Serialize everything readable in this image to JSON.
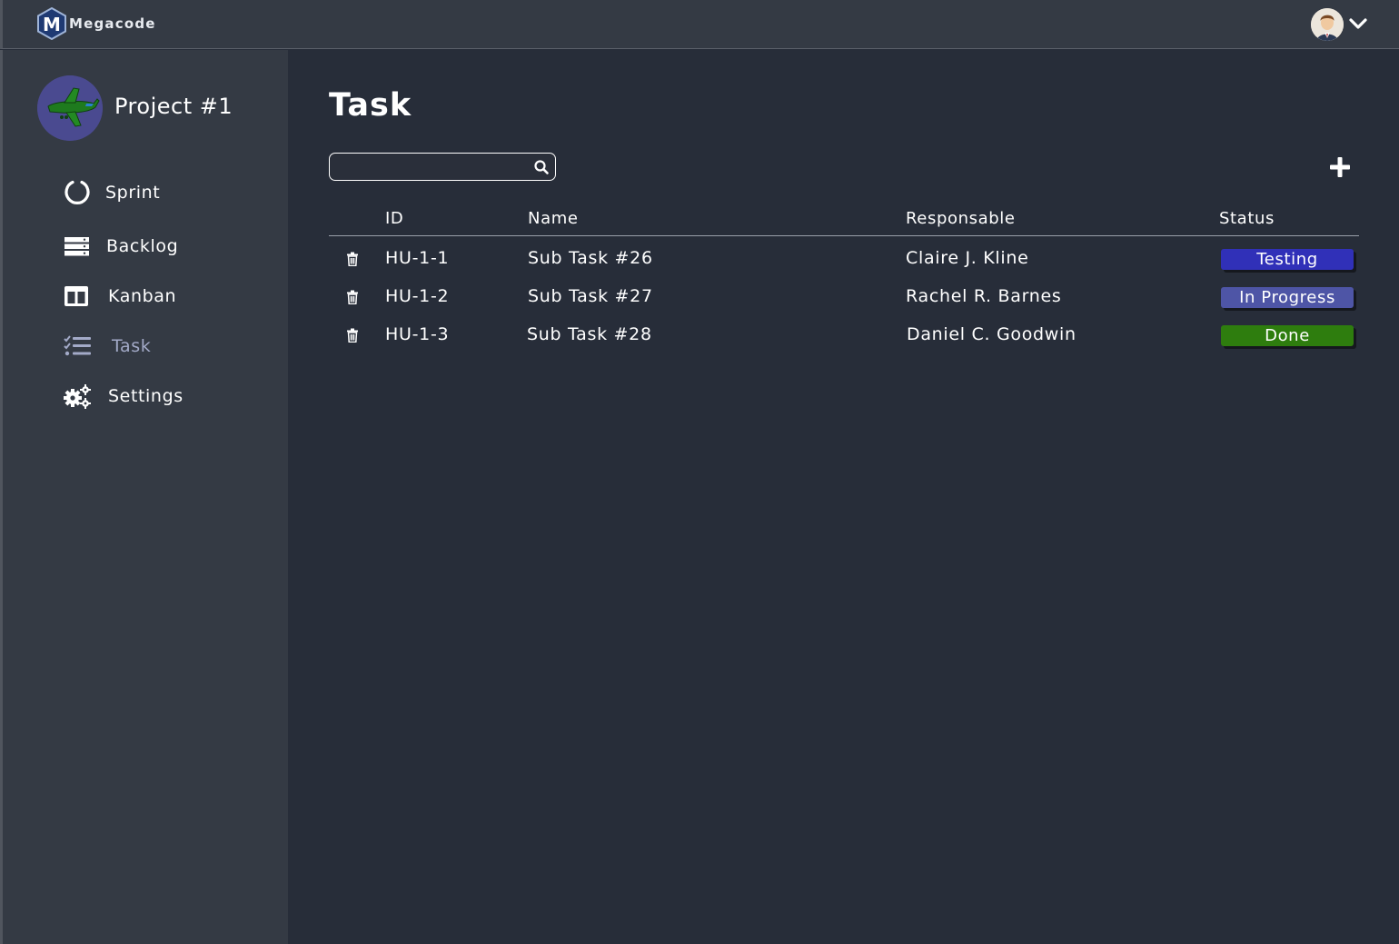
{
  "app": {
    "brand": "Megacode"
  },
  "colors": {
    "background": "#272d39",
    "sidebar": "#343a44",
    "testing": "#3030b8",
    "in_progress": "#4e55a6",
    "done": "#2e7d0e"
  },
  "sidebar": {
    "project_name": "Project #1",
    "items": [
      {
        "label": "Sprint",
        "icon": "circle-notch-icon",
        "active": false
      },
      {
        "label": "Backlog",
        "icon": "server-icon",
        "active": false
      },
      {
        "label": "Kanban",
        "icon": "columns-icon",
        "active": false
      },
      {
        "label": "Task",
        "icon": "tasks-icon",
        "active": true
      },
      {
        "label": "Settings",
        "icon": "cogs-icon",
        "active": false
      }
    ]
  },
  "main": {
    "title": "Task",
    "search": {
      "value": "",
      "placeholder": ""
    },
    "table": {
      "headers": [
        "ID",
        "Name",
        "Responsable",
        "Status"
      ],
      "rows": [
        {
          "id": "HU-1-1",
          "name": "Sub Task #26",
          "responsable": "Claire J. Kline",
          "status": "Testing"
        },
        {
          "id": "HU-1-2",
          "name": "Sub Task #27",
          "responsable": "Rachel R. Barnes",
          "status": "In Progress"
        },
        {
          "id": "HU-1-3",
          "name": "Sub Task #28",
          "responsable": "Daniel C. Goodwin",
          "status": "Done"
        }
      ]
    }
  }
}
